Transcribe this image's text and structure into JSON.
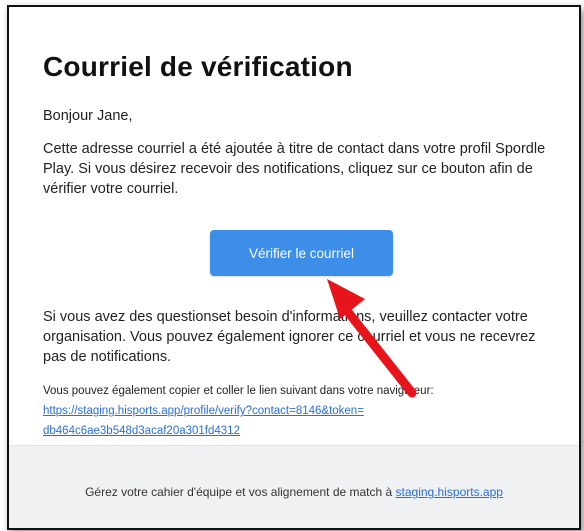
{
  "email": {
    "title": "Courriel de vérification",
    "greeting": "Bonjour Jane,",
    "intro": "Cette adresse courriel a été ajoutée à titre de contact dans votre profil Spordle Play. Si vous désirez recevoir des notifications, cliquez sur ce bouton afin de vérifier votre courriel.",
    "button_label": "Vérifier le courriel",
    "after_button": "Si vous avez des questionset besoin d'informations, veuillez contacter votre organisation. Vous pouvez également ignorer ce courriel et vous ne recevrez pas de notifications.",
    "copy_label": "Vous pouvez également copier et coller le lien suivant dans votre navigateur:",
    "link_line1": "https://staging.hisports.app/profile/verify?contact=8146&token=",
    "link_line2": "db464c6ae3b548d3acaf20a301fd4312"
  },
  "footer": {
    "text": "Gérez votre cahier d'équipe et vos alignement de match à ",
    "link": "staging.hisports.app"
  },
  "annotation": {
    "icon": "red-arrow-icon",
    "color": "#e8141b"
  },
  "colors": {
    "button": "#3d8ee8",
    "link": "#2a6fd6",
    "footer_bg": "#f0f1f3"
  }
}
